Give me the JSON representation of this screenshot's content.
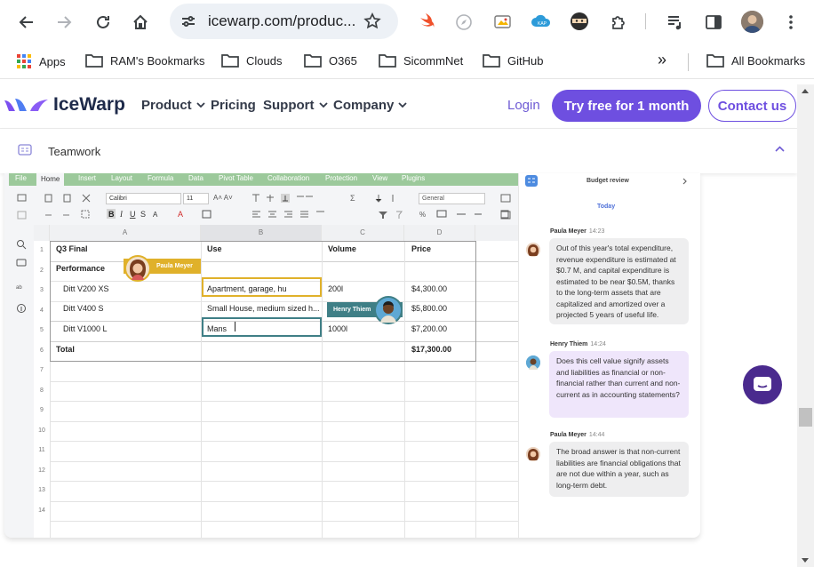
{
  "browser": {
    "url": "icewarp.com/produc...",
    "bookmarks": [
      {
        "label": "Apps"
      },
      {
        "label": "RAM's Bookmarks"
      },
      {
        "label": "Clouds"
      },
      {
        "label": "O365"
      },
      {
        "label": "SicommNet"
      },
      {
        "label": "GitHub"
      }
    ],
    "all_bookmarks": "All Bookmarks",
    "overflow": "»"
  },
  "site": {
    "brand": "IceWarp",
    "nav": [
      "Product",
      "Pricing",
      "Support",
      "Company"
    ],
    "login": "Login",
    "try_free": "Try free for 1 month",
    "contact": "Contact us",
    "subnav_label": "Teamwork"
  },
  "spreadsheet": {
    "ribbon_tabs": [
      "File",
      "Home",
      "Insert",
      "Layout",
      "Formula",
      "Data",
      "Pivot Table",
      "Collaboration",
      "Protection",
      "View",
      "Plugins"
    ],
    "font": "Calibri",
    "font_size": "11",
    "number_format": "General",
    "columns": [
      "A",
      "B",
      "C",
      "D"
    ],
    "rows": [
      "1",
      "2",
      "3",
      "4",
      "5",
      "6",
      "7",
      "8",
      "9",
      "10",
      "11",
      "12",
      "13",
      "14"
    ],
    "header": [
      "Q3 Final",
      "Use",
      "Volume",
      "Price"
    ],
    "section": "Performance",
    "data": [
      [
        "Ditt V200 XS",
        "Apartment, garage, hu",
        "200l",
        "$4,300.00"
      ],
      [
        "Ditt V400 S",
        "Small House, medium sized h...",
        "",
        "$5,800.00"
      ],
      [
        "Ditt V1000 L",
        "Mans",
        "1000l",
        "$7,200.00"
      ]
    ],
    "total_label": "Total",
    "total_value": "$17,300.00",
    "cursor_paula": "Paula Meyer",
    "cursor_henry": "Henry Thiem"
  },
  "chat": {
    "title": "Budget review",
    "day": "Today",
    "messages": [
      {
        "name": "Paula Meyer",
        "time": "14:23",
        "text": "Out of this year's total expenditure, revenue expenditure is estimated at $0.7 M, and capital expenditure is estimated to be near $0.5M, thanks to the long-term assets that are capitalized and amortized over a projected 5 years of useful life."
      },
      {
        "name": "Henry Thiem",
        "time": "14:24",
        "text": "Does this cell value signify assets and liabilities as financial or non-financial rather than current and non-current as in accounting statements?"
      },
      {
        "name": "Paula Meyer",
        "time": "14:44",
        "text": "The broad answer is that non-current liabilities are financial obligations that are not due within a year, such as long-term debt."
      }
    ]
  },
  "colors": {
    "accent": "#6e4fe0",
    "ribbon_green": "#9cc99b",
    "cursor_paula": "#e0b12a",
    "cursor_henry": "#3f7f86",
    "bubble_grey": "#eeeeef",
    "bubble_lilac": "#efe6fb"
  }
}
